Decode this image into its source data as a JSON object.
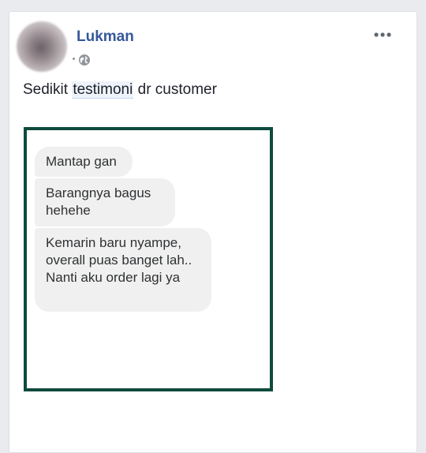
{
  "post": {
    "author": "Lukman",
    "privacy_icon": "globe-icon",
    "more_icon": "more-options-icon",
    "caption_before": "Sedikit ",
    "caption_hashtag": "testimoni",
    "caption_after": " dr customer"
  },
  "chat": {
    "messages": [
      "Mantap gan",
      "Barangnya bagus hehehe",
      "Kemarin baru nyampe, overall puas banget lah.. Nanti aku order lagi ya"
    ]
  },
  "colors": {
    "author_link": "#365899",
    "frame_border": "#0f4a3e",
    "bubble_bg": "#f0f0f0",
    "page_bg": "#e9ebee"
  }
}
